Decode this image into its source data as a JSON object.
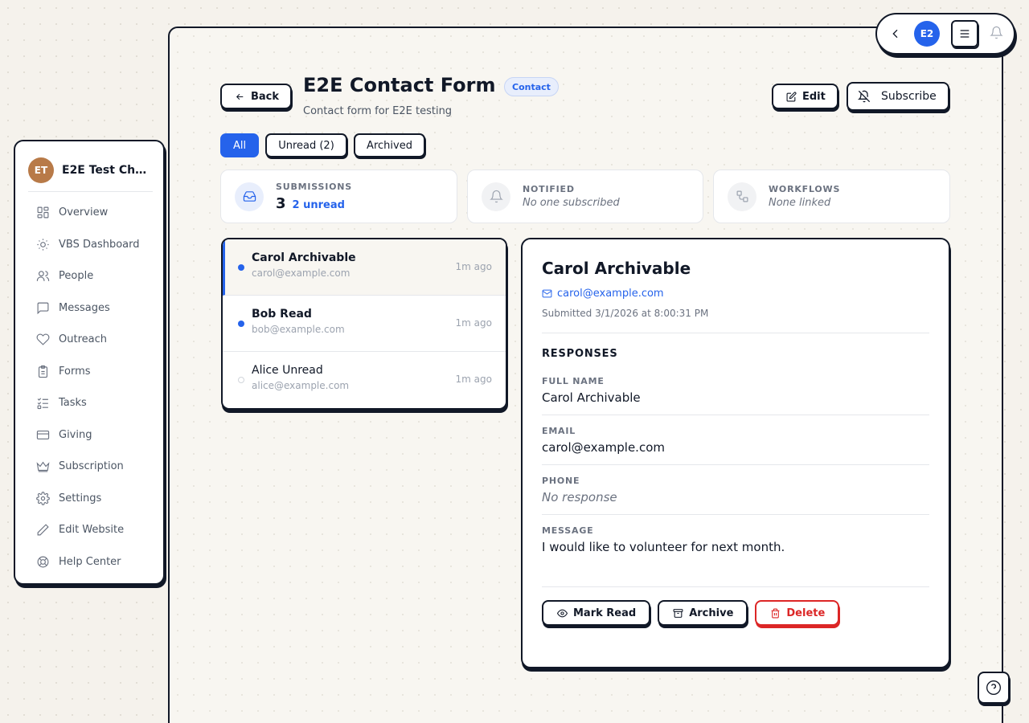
{
  "sidebar": {
    "org_initials": "ET",
    "org_name": "E2E Test Church",
    "items": [
      {
        "label": "Overview",
        "icon": "layout-grid-icon"
      },
      {
        "label": "VBS Dashboard",
        "icon": "sun-icon"
      },
      {
        "label": "People",
        "icon": "users-icon"
      },
      {
        "label": "Messages",
        "icon": "message-icon"
      },
      {
        "label": "Outreach",
        "icon": "heart-icon"
      },
      {
        "label": "Forms",
        "icon": "clipboard-icon"
      },
      {
        "label": "Tasks",
        "icon": "checklist-icon"
      },
      {
        "label": "Giving",
        "icon": "credit-card-icon"
      },
      {
        "label": "Subscription",
        "icon": "crown-icon"
      },
      {
        "label": "Settings",
        "icon": "gear-icon"
      },
      {
        "label": "Edit Website",
        "icon": "pencil-icon"
      },
      {
        "label": "Help Center",
        "icon": "lifebuoy-icon"
      }
    ]
  },
  "topbar": {
    "user_initials": "E2"
  },
  "header": {
    "back_label": "Back",
    "title": "E2E Contact Form",
    "badge": "Contact",
    "subtitle": "Contact form for E2E testing",
    "edit_label": "Edit",
    "subscribe_label": "Subscribe"
  },
  "tabs": {
    "all": "All",
    "unread": "Unread (2)",
    "archived": "Archived",
    "selected": "All"
  },
  "stats": {
    "submissions": {
      "label": "SUBMISSIONS",
      "count": "3",
      "unread": "2 unread"
    },
    "notified": {
      "label": "NOTIFIED",
      "value": "No one subscribed"
    },
    "workflows": {
      "label": "WORKFLOWS",
      "value": "None linked"
    }
  },
  "submissions": [
    {
      "name": "Carol Archivable",
      "email": "carol@example.com",
      "time": "1m ago"
    },
    {
      "name": "Bob Read",
      "email": "bob@example.com",
      "time": "1m ago"
    },
    {
      "name": "Alice Unread",
      "email": "alice@example.com",
      "time": "1m ago"
    }
  ],
  "detail": {
    "name": "Carol Archivable",
    "email": "carol@example.com",
    "submitted": "Submitted 3/1/2026 at 8:00:31 PM",
    "responses_title": "RESPONSES",
    "fields": [
      {
        "label": "FULL NAME",
        "value": "Carol Archivable"
      },
      {
        "label": "EMAIL",
        "value": "carol@example.com"
      },
      {
        "label": "PHONE",
        "value": "No response"
      },
      {
        "label": "MESSAGE",
        "value": "I would like to volunteer for next month."
      }
    ],
    "mark_read_label": "Mark Read",
    "archive_label": "Archive",
    "delete_label": "Delete"
  },
  "colors": {
    "accent": "#2563eb",
    "danger": "#dc2626",
    "background": "#f5f2ec",
    "org_avatar": "#b87a48"
  }
}
